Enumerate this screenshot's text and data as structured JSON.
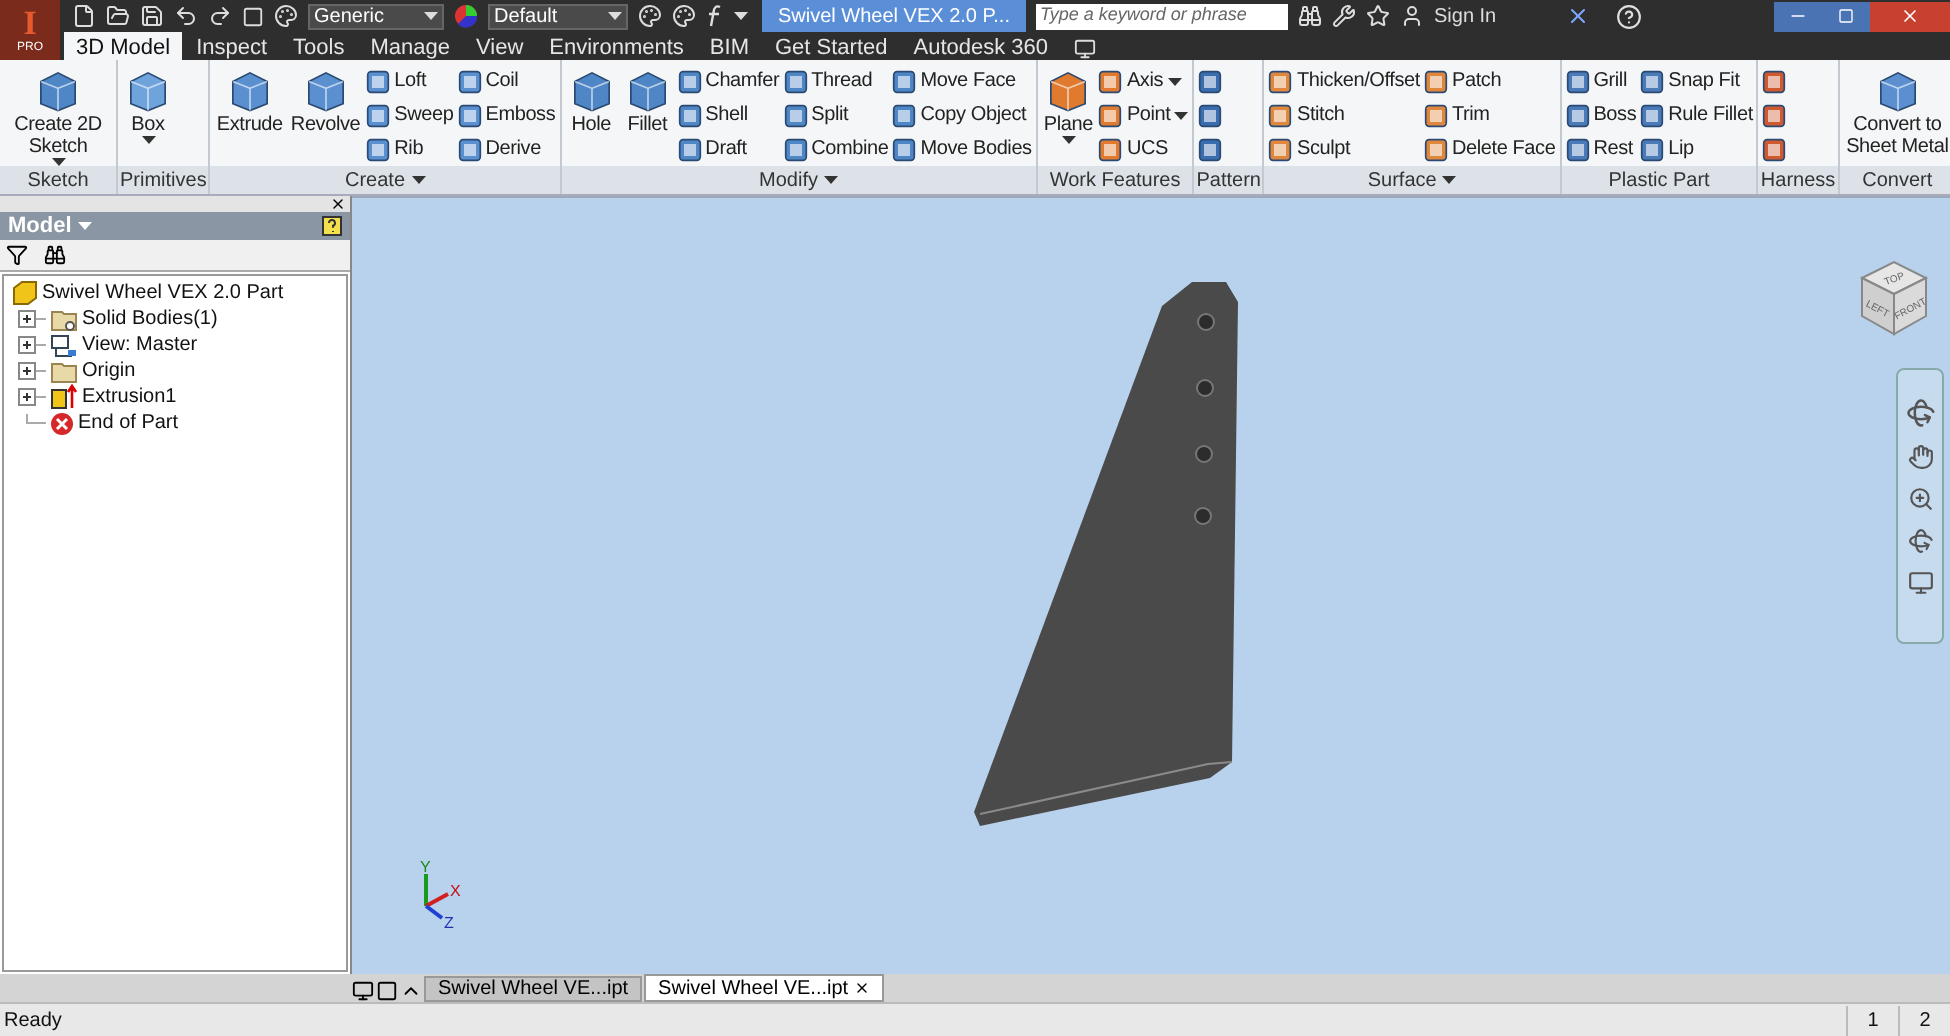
{
  "app_button": {
    "letter": "I",
    "edition": "PRO"
  },
  "quick_access": {
    "material": "Generic",
    "appearance": "Default"
  },
  "document_title": "Swivel Wheel VEX 2.0 P...",
  "search": {
    "placeholder": "Type a keyword or phrase"
  },
  "sign_in": "Sign In",
  "ribbon_tabs": [
    {
      "label": "3D Model",
      "selected": true
    },
    {
      "label": "Inspect",
      "selected": false
    },
    {
      "label": "Tools",
      "selected": false
    },
    {
      "label": "Manage",
      "selected": false
    },
    {
      "label": "View",
      "selected": false
    },
    {
      "label": "Environments",
      "selected": false
    },
    {
      "label": "BIM",
      "selected": false
    },
    {
      "label": "Get Started",
      "selected": false
    },
    {
      "label": "Autodesk 360",
      "selected": false
    }
  ],
  "ribbon_panels": [
    {
      "title": "Sketch",
      "has_menu": false,
      "groups": [
        {
          "kind": "large",
          "tools": [
            {
              "label": "Create 2D Sketch",
              "dropdown": true
            }
          ]
        }
      ]
    },
    {
      "title": "Primitives",
      "has_menu": false,
      "groups": [
        {
          "kind": "large",
          "tools": [
            {
              "label": "Box",
              "dropdown": true
            }
          ]
        }
      ]
    },
    {
      "title": "Create",
      "has_menu": true,
      "groups": [
        {
          "kind": "large",
          "tools": [
            {
              "label": "Extrude",
              "dropdown": false
            },
            {
              "label": "Revolve",
              "dropdown": false
            }
          ]
        },
        {
          "kind": "column",
          "tools": [
            {
              "label": "Loft",
              "dropdown": false
            },
            {
              "label": "Sweep",
              "dropdown": false
            },
            {
              "label": "Rib",
              "dropdown": false
            }
          ]
        },
        {
          "kind": "column",
          "tools": [
            {
              "label": "Coil",
              "dropdown": false
            },
            {
              "label": "Emboss",
              "dropdown": false
            },
            {
              "label": "Derive",
              "dropdown": false
            }
          ]
        }
      ]
    },
    {
      "title": "Modify",
      "has_menu": true,
      "groups": [
        {
          "kind": "large",
          "tools": [
            {
              "label": "Hole",
              "dropdown": false
            },
            {
              "label": "Fillet",
              "dropdown": false
            }
          ]
        },
        {
          "kind": "column",
          "tools": [
            {
              "label": "Chamfer",
              "dropdown": false
            },
            {
              "label": "Shell",
              "dropdown": false
            },
            {
              "label": "Draft",
              "dropdown": false
            }
          ]
        },
        {
          "kind": "column",
          "tools": [
            {
              "label": "Thread",
              "dropdown": false
            },
            {
              "label": "Split",
              "dropdown": false
            },
            {
              "label": "Combine",
              "dropdown": false
            }
          ]
        },
        {
          "kind": "column",
          "tools": [
            {
              "label": "Move Face",
              "dropdown": false
            },
            {
              "label": "Copy Object",
              "dropdown": false
            },
            {
              "label": "Move Bodies",
              "dropdown": false
            }
          ]
        }
      ]
    },
    {
      "title": "Work Features",
      "has_menu": false,
      "groups": [
        {
          "kind": "large",
          "tools": [
            {
              "label": "Plane",
              "dropdown": true
            }
          ]
        },
        {
          "kind": "column",
          "tools": [
            {
              "label": "Axis",
              "dropdown": true
            },
            {
              "label": "Point",
              "dropdown": true
            },
            {
              "label": "UCS",
              "dropdown": false
            }
          ]
        }
      ]
    },
    {
      "title": "Pattern",
      "has_menu": false,
      "groups": [
        {
          "kind": "column",
          "tools": [
            {
              "dropdown": false
            },
            {
              "dropdown": false
            },
            {
              "dropdown": false
            }
          ]
        }
      ]
    },
    {
      "title": "Surface",
      "has_menu": true,
      "groups": [
        {
          "kind": "column",
          "tools": [
            {
              "label": "Thicken/Offset",
              "dropdown": false
            },
            {
              "label": "Stitch",
              "dropdown": false
            },
            {
              "label": "Sculpt",
              "dropdown": false
            }
          ]
        },
        {
          "kind": "column",
          "tools": [
            {
              "label": "Patch",
              "dropdown": false
            },
            {
              "label": "Trim",
              "dropdown": false
            },
            {
              "label": "Delete Face",
              "dropdown": false
            }
          ]
        }
      ]
    },
    {
      "title": "Plastic Part",
      "has_menu": false,
      "groups": [
        {
          "kind": "column",
          "tools": [
            {
              "label": "Grill",
              "dropdown": false
            },
            {
              "label": "Boss",
              "dropdown": false
            },
            {
              "label": "Rest",
              "dropdown": false
            }
          ]
        },
        {
          "kind": "column",
          "tools": [
            {
              "label": "Snap Fit",
              "dropdown": false
            },
            {
              "label": "Rule Fillet",
              "dropdown": false
            },
            {
              "label": "Lip",
              "dropdown": false
            }
          ]
        }
      ]
    },
    {
      "title": "Harness",
      "has_menu": false,
      "groups": [
        {
          "kind": "column",
          "tools": [
            {
              "dropdown": false
            },
            {
              "dropdown": false
            },
            {
              "dropdown": false
            }
          ]
        }
      ]
    },
    {
      "title": "Convert",
      "has_menu": false,
      "groups": [
        {
          "kind": "large",
          "tools": [
            {
              "label": "Convert to Sheet Metal",
              "dropdown": false
            }
          ]
        }
      ]
    }
  ],
  "browser": {
    "title": "Model",
    "tree": [
      {
        "label": "Swivel Wheel VEX 2.0 Part",
        "kind": "part",
        "children": [
          {
            "label": "Solid Bodies(1)",
            "kind": "bodies",
            "expandable": true
          },
          {
            "label": "View: Master",
            "kind": "view",
            "expandable": true
          },
          {
            "label": "Origin",
            "kind": "folder",
            "expandable": true
          },
          {
            "label": "Extrusion1",
            "kind": "extrusion",
            "expandable": true
          },
          {
            "label": "End of Part",
            "kind": "end",
            "expandable": false
          }
        ]
      }
    ]
  },
  "viewport": {
    "view_cube": [
      "TOP",
      "LEFT",
      "FRONT"
    ],
    "axes": [
      "Y",
      "X",
      "Z"
    ]
  },
  "document_tabs": [
    {
      "label": "Swivel Wheel VE...ipt",
      "selected": false
    },
    {
      "label": "Swivel Wheel VE...ipt",
      "selected": true
    }
  ],
  "status_bar": {
    "message": "Ready",
    "cells": [
      "1",
      "2"
    ]
  }
}
